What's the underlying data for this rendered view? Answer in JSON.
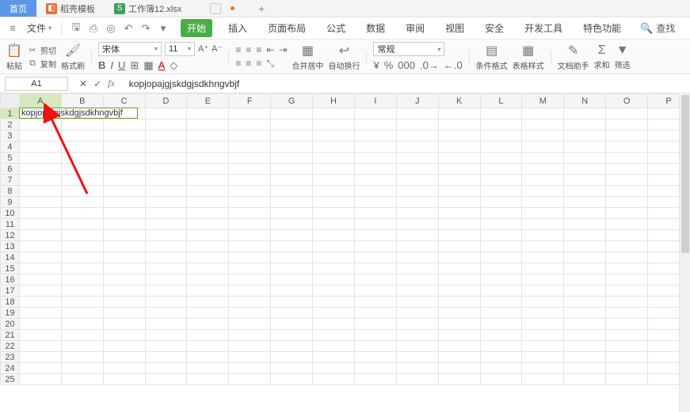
{
  "tabs": {
    "home": "首页",
    "templates": "稻壳模板",
    "workbook": "工作簿12.xlsx"
  },
  "file_menu": {
    "label": "文件"
  },
  "ribbon_tabs": {
    "start": "开始",
    "insert": "插入",
    "page_layout": "页面布局",
    "formula": "公式",
    "data": "数据",
    "review": "审阅",
    "view": "视图",
    "security": "安全",
    "dev": "开发工具",
    "special": "特色功能",
    "search": "查找"
  },
  "ribbon": {
    "paste": "粘贴",
    "cut": "剪切",
    "copy": "复制",
    "format_painter": "格式刷",
    "font_name": "宋体",
    "font_size": "11",
    "merge_center": "合并居中",
    "auto_wrap": "自动换行",
    "number_format": "常规",
    "cond_fmt": "条件格式",
    "table_style": "表格样式",
    "doc_helper": "文档助手",
    "sum": "求和",
    "filter": "筛选"
  },
  "address": {
    "cell_ref": "A1",
    "formula": "kopjopajgjskdgjsdkhngvbjf"
  },
  "columns": [
    "A",
    "B",
    "C",
    "D",
    "E",
    "F",
    "G",
    "H",
    "I",
    "J",
    "K",
    "L",
    "M",
    "N",
    "O",
    "P"
  ],
  "rows": 25,
  "cell_a1": "kopjopajgjskdgjsdkhngvbjf"
}
